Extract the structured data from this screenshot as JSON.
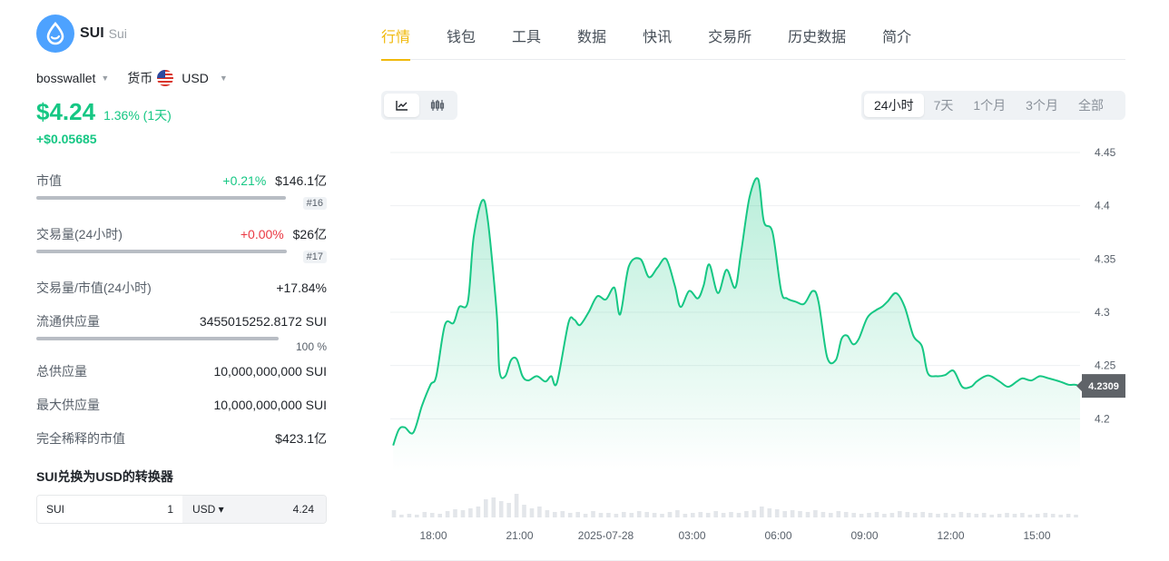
{
  "coin": {
    "symbol": "SUI",
    "name": "Sui",
    "logo_color": "#4da2ff"
  },
  "selectors": {
    "wallet": "bosswallet",
    "currency_label": "货币",
    "currency": "USD"
  },
  "price": {
    "value": "$4.24",
    "change_pct": "1.36% (1天)",
    "change_abs": "+$0.05685"
  },
  "stats": {
    "market_cap": {
      "label": "市值",
      "delta": "+0.21%",
      "value": "$146.1亿",
      "rank": "#16"
    },
    "volume": {
      "label": "交易量(24小时)",
      "delta": "+0.00%",
      "value": "$26亿",
      "rank": "#17"
    },
    "vol_mcap": {
      "label": "交易量/市值(24小时)",
      "value": "+17.84%"
    },
    "circulating": {
      "label": "流通供应量",
      "value": "3455015252.8172 SUI",
      "percent": "100 %"
    },
    "total_supply": {
      "label": "总供应量",
      "value": "10,000,000,000 SUI"
    },
    "max_supply": {
      "label": "最大供应量",
      "value": "10,000,000,000 SUI"
    },
    "fdv": {
      "label": "完全稀释的市值",
      "value": "$423.1亿"
    }
  },
  "converter": {
    "title": "SUI兑换为USD的转换器",
    "from_symbol": "SUI",
    "from_amount": "1",
    "to_symbol": "USD ▾",
    "to_amount": "4.24"
  },
  "tabs": [
    "行情",
    "钱包",
    "工具",
    "数据",
    "快讯",
    "交易所",
    "历史数据",
    "简介"
  ],
  "chart_types": {
    "line_icon": "line-chart-icon",
    "candle_icon": "candlestick-icon"
  },
  "ranges": [
    "24小时",
    "7天",
    "1个月",
    "3个月",
    "全部"
  ],
  "colors": {
    "up": "#16c784",
    "down": "#ea3943",
    "accent": "#f0b90b"
  },
  "chart_data": {
    "type": "area",
    "x_labels": [
      "18:00",
      "21:00",
      "2025-07-28",
      "03:00",
      "06:00",
      "09:00",
      "12:00",
      "15:00"
    ],
    "y_ticks": [
      4.2,
      4.25,
      4.3,
      4.35,
      4.4,
      4.45
    ],
    "ylim": [
      4.15,
      4.45
    ],
    "xlim": [
      -0.5,
      23.5
    ],
    "current_price": "4.2309",
    "series": [
      {
        "x": [
          -0.4,
          -0.2,
          0,
          0.3,
          0.6,
          0.9,
          1.1,
          1.4,
          1.7,
          1.9,
          2.2,
          2.4,
          2.7,
          2.9,
          3.2,
          3.3,
          3.5,
          3.7,
          3.9,
          4.1,
          4.3,
          4.6,
          4.9,
          5.1,
          5.3,
          5.7,
          5.9,
          6.1,
          6.4,
          6.7,
          7,
          7.3,
          7.5,
          7.8,
          8.2,
          8.5,
          8.8,
          9.1,
          9.4,
          9.6,
          9.9,
          10.2,
          10.4,
          10.6,
          10.9,
          11.2,
          11.5,
          11.7,
          12,
          12.3,
          12.5,
          12.8,
          13.1,
          13.3,
          13.6,
          13.9,
          14.2,
          14.4,
          14.7,
          15,
          15.2,
          15.4,
          15.6,
          15.8,
          16.1,
          16.4,
          16.6,
          16.8,
          17.1,
          17.4,
          17.7,
          18,
          18.2,
          18.5,
          18.8,
          19.1,
          19.4,
          19.7,
          19.9,
          20.2,
          20.4,
          20.7,
          21,
          21.3,
          21.5,
          21.8,
          22.1,
          22.4,
          22.8,
          23.1,
          23.3,
          23.5
        ],
        "values": [
          4.175,
          4.19,
          4.192,
          4.187,
          4.212,
          4.232,
          4.24,
          4.288,
          4.29,
          4.305,
          4.31,
          4.37,
          4.405,
          4.385,
          4.3,
          4.245,
          4.24,
          4.255,
          4.256,
          4.24,
          4.236,
          4.24,
          4.235,
          4.24,
          4.234,
          4.29,
          4.293,
          4.288,
          4.3,
          4.315,
          4.312,
          4.323,
          4.298,
          4.343,
          4.35,
          4.333,
          4.342,
          4.35,
          4.325,
          4.305,
          4.32,
          4.313,
          4.325,
          4.345,
          4.318,
          4.34,
          4.323,
          4.355,
          4.408,
          4.425,
          4.385,
          4.375,
          4.32,
          4.313,
          4.31,
          4.308,
          4.32,
          4.31,
          4.258,
          4.255,
          4.275,
          4.278,
          4.27,
          4.275,
          4.295,
          4.302,
          4.305,
          4.31,
          4.318,
          4.305,
          4.278,
          4.268,
          4.243,
          4.24,
          4.241,
          4.245,
          4.23,
          4.23,
          4.235,
          4.24,
          4.24,
          4.235,
          4.23,
          4.235,
          4.238,
          4.236,
          4.24,
          4.238,
          4.235,
          4.232,
          4.232,
          4.231
        ]
      }
    ],
    "volume": [
      8,
      3,
      4,
      3,
      6,
      5,
      4,
      7,
      9,
      8,
      10,
      12,
      20,
      22,
      18,
      16,
      26,
      14,
      10,
      12,
      8,
      6,
      7,
      5,
      6,
      4,
      7,
      5,
      5,
      4,
      6,
      5,
      7,
      6,
      5,
      4,
      6,
      8,
      4,
      5,
      6,
      5,
      7,
      5,
      6,
      5,
      7,
      8,
      12,
      10,
      9,
      7,
      8,
      7,
      6,
      8,
      6,
      5,
      7,
      6,
      5,
      4,
      5,
      6,
      4,
      5,
      7,
      6,
      5,
      6,
      5,
      4,
      5,
      4,
      6,
      5,
      4,
      5,
      3,
      4,
      5,
      4,
      5,
      3,
      4,
      5,
      4,
      3,
      4,
      3
    ]
  }
}
